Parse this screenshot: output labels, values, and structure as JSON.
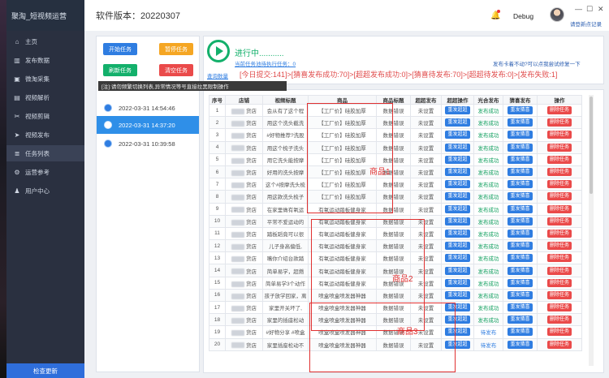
{
  "sidebar": {
    "title": "聚淘_短视频运营",
    "items": [
      {
        "label": "主页",
        "icon": "home-icon",
        "glyph": "⌂"
      },
      {
        "label": "发布数据",
        "icon": "bar-chart-icon",
        "glyph": "▥"
      },
      {
        "label": "微淘采集",
        "icon": "image-icon",
        "glyph": "▣"
      },
      {
        "label": "视频解析",
        "icon": "video-icon",
        "glyph": "▤"
      },
      {
        "label": "视频剪辑",
        "icon": "scissors-icon",
        "glyph": "✂"
      },
      {
        "label": "视频发布",
        "icon": "send-icon",
        "glyph": "➤"
      },
      {
        "label": "任务列表",
        "icon": "list-icon",
        "glyph": "≣"
      },
      {
        "label": "运营参考",
        "icon": "gear-icon",
        "glyph": "⚙"
      },
      {
        "label": "用户中心",
        "icon": "user-icon",
        "glyph": "♟"
      }
    ],
    "footer": "检查更新"
  },
  "topbar": {
    "version_label": "软件版本：20220307",
    "debug": "Debug",
    "user_link": "请登新点记录",
    "min": "—",
    "max": "☐",
    "close": "✕"
  },
  "actions": {
    "start": "开始任务",
    "pause": "暂停任务",
    "refresh": "刷新任务",
    "clear": "清空任务",
    "tip": "[注]:请勿频繁切换列表,异常情况等号直接拉黑限制操作"
  },
  "tasks": [
    {
      "time": "2022-03-31 14:54:46"
    },
    {
      "time": "2022-03-31 14:37:20"
    },
    {
      "time": "2022-03-31 10:39:58"
    }
  ],
  "status": {
    "running": "进行中...........",
    "current_task": "当前任务池待执行任务：0",
    "query": "查询数量",
    "hint": "发布卡着不动?可以点我尝试修复一下",
    "stats": "[今日提交:141]>[猜喜发布成功:70]>[超超发布成功:0]>[猜喜待发布:70]>[超超待发布:0]>[发布失败:1]"
  },
  "table": {
    "headers": [
      "序号",
      "店铺",
      "视频标题",
      "商品",
      "商品标题",
      "超超发布",
      "超超操作",
      "光合发布",
      "猜喜发布",
      "操作"
    ],
    "shop_suffix": "货店",
    "rows": [
      {
        "no": "1",
        "title": "会从有了这个程",
        "goods": "【工厂价】硅胶加厚",
        "gtitle": "数据错误",
        "pub": "未设置",
        "op": "重发超超",
        "gh": "发布成功",
        "gh_type": "green",
        "cx": "重发猜喜",
        "del": "删除任务"
      },
      {
        "no": "2",
        "title": "用这个洗头截洗",
        "goods": "【工厂价】硅胶加厚",
        "gtitle": "数据错误",
        "pub": "未设置",
        "op": "重发超超",
        "gh": "发布成功",
        "gh_type": "green",
        "cx": "重发猜喜",
        "del": "删除任务"
      },
      {
        "no": "3",
        "title": "#好物推荐?洗股",
        "goods": "【工厂价】硅胶加厚",
        "gtitle": "数据错误",
        "pub": "未设置",
        "op": "重发超超",
        "gh": "发布成功",
        "gh_type": "green",
        "cx": "重发猜喜",
        "del": "删除任务"
      },
      {
        "no": "4",
        "title": "用这个梳子洗头",
        "goods": "【工厂价】硅胶加厚",
        "gtitle": "数据错误",
        "pub": "未设置",
        "op": "重发超超",
        "gh": "发布成功",
        "gh_type": "green",
        "cx": "重发猜喜",
        "del": "删除任务"
      },
      {
        "no": "5",
        "title": "用它洗头能按摩",
        "goods": "【工厂价】硅胶加厚",
        "gtitle": "数据错误",
        "pub": "未设置",
        "op": "重发超超",
        "gh": "发布成功",
        "gh_type": "green",
        "cx": "重发猜喜",
        "del": "删除任务"
      },
      {
        "no": "6",
        "title": "好用的洗头按摩",
        "goods": "【工厂价】硅胶加厚",
        "gtitle": "数据错误",
        "pub": "未设置",
        "op": "重发超超",
        "gh": "发布成功",
        "gh_type": "green",
        "cx": "重发猜喜",
        "del": "删除任务"
      },
      {
        "no": "7",
        "title": "这个#按摩洗头梳",
        "goods": "【工厂价】硅胶加厚",
        "gtitle": "数据错误",
        "pub": "未设置",
        "op": "重发超超",
        "gh": "发布成功",
        "gh_type": "green",
        "cx": "重发猜喜",
        "del": "删除任务"
      },
      {
        "no": "8",
        "title": "用这款洗头梳子",
        "goods": "【工厂价】硅胶加厚",
        "gtitle": "数据错误",
        "pub": "未设置",
        "op": "重发超超",
        "gh": "发布成功",
        "gh_type": "green",
        "cx": "重发猜喜",
        "del": "删除任务"
      },
      {
        "no": "9",
        "title": "在家里做有氧运",
        "goods": "有氧运动踏板健身家",
        "gtitle": "数据错误",
        "pub": "未设置",
        "op": "重发超超",
        "gh": "发布成功",
        "gh_type": "green",
        "cx": "重发猜喜",
        "del": "删除任务"
      },
      {
        "no": "10",
        "title": "平常不爱运动的",
        "goods": "有氧运动踏板健身家",
        "gtitle": "数据错误",
        "pub": "未设置",
        "op": "重发超超",
        "gh": "发布成功",
        "gh_type": "green",
        "cx": "重发猜喜",
        "del": "删除任务"
      },
      {
        "no": "11",
        "title": "踏板蹈竟可以很",
        "goods": "有氧运动踏板健身家",
        "gtitle": "数据错误",
        "pub": "未设置",
        "op": "重发超超",
        "gh": "发布成功",
        "gh_type": "green",
        "cx": "重发猜喜",
        "del": "删除任务"
      },
      {
        "no": "12",
        "title": "儿子身高偏低,",
        "goods": "有氧运动踏板健身家",
        "gtitle": "数据错误",
        "pub": "未设置",
        "op": "重发超超",
        "gh": "发布成功",
        "gh_type": "green",
        "cx": "重发猜喜",
        "del": "删除任务"
      },
      {
        "no": "13",
        "title": "嘴你介绍台款踏",
        "goods": "有氧运动踏板健身家",
        "gtitle": "数据错误",
        "pub": "未设置",
        "op": "重发超超",
        "gh": "发布成功",
        "gh_type": "green",
        "cx": "重发猜喜",
        "del": "删除任务"
      },
      {
        "no": "14",
        "title": "简单易学，超燃",
        "goods": "有氧运动踏板健身家",
        "gtitle": "数据错误",
        "pub": "未设置",
        "op": "重发超超",
        "gh": "发布成功",
        "gh_type": "green",
        "cx": "重发猜喜",
        "del": "删除任务"
      },
      {
        "no": "15",
        "title": "简单易学3个动作",
        "goods": "有氧运动踏板健身家",
        "gtitle": "数据错误",
        "pub": "未设置",
        "op": "重发超超",
        "gh": "发布成功",
        "gh_type": "green",
        "cx": "重发猜喜",
        "del": "删除任务"
      },
      {
        "no": "16",
        "title": "孩子放学回家，离",
        "goods": "喷盒喷盒喷发器神器",
        "gtitle": "数据错误",
        "pub": "未设置",
        "op": "重发超超",
        "gh": "发布成功",
        "gh_type": "green",
        "cx": "重发猜喜",
        "del": "删除任务"
      },
      {
        "no": "17",
        "title": "家里开关坏了,",
        "goods": "喷盒喷盒喷发器神器",
        "gtitle": "数据错误",
        "pub": "未设置",
        "op": "重发超超",
        "gh": "发布成功",
        "gh_type": "green",
        "cx": "重发猜喜",
        "del": "删除任务"
      },
      {
        "no": "18",
        "title": "家里的插座松动",
        "goods": "喷盒喷盒喷发器神器",
        "gtitle": "数据错误",
        "pub": "未设置",
        "op": "重发超超",
        "gh": "发布成功",
        "gh_type": "green",
        "cx": "重发猜喜",
        "del": "删除任务"
      },
      {
        "no": "19",
        "title": "#好物分享 #喷盒",
        "goods": "喷盒喷盒喷发器神器",
        "gtitle": "数据错误",
        "pub": "未设置",
        "op": "重发超超",
        "gh": "待发布",
        "gh_type": "blue",
        "cx": "重发猜喜",
        "del": "删除任务"
      },
      {
        "no": "20",
        "title": "家里插座松动不",
        "goods": "喷盒喷盒喷发器神器",
        "gtitle": "数据错误",
        "pub": "未设置",
        "op": "重发超超",
        "gh": "待发布",
        "gh_type": "blue",
        "cx": "重发猜喜",
        "del": "删除任务"
      }
    ]
  },
  "annotations": [
    "商品1",
    "商品2",
    "商品3"
  ],
  "colors": {
    "primary": "#2f7de1",
    "success": "#13b06b",
    "warning": "#f5a623",
    "danger": "#ea4a4a",
    "sidebar": "#2a3040"
  }
}
